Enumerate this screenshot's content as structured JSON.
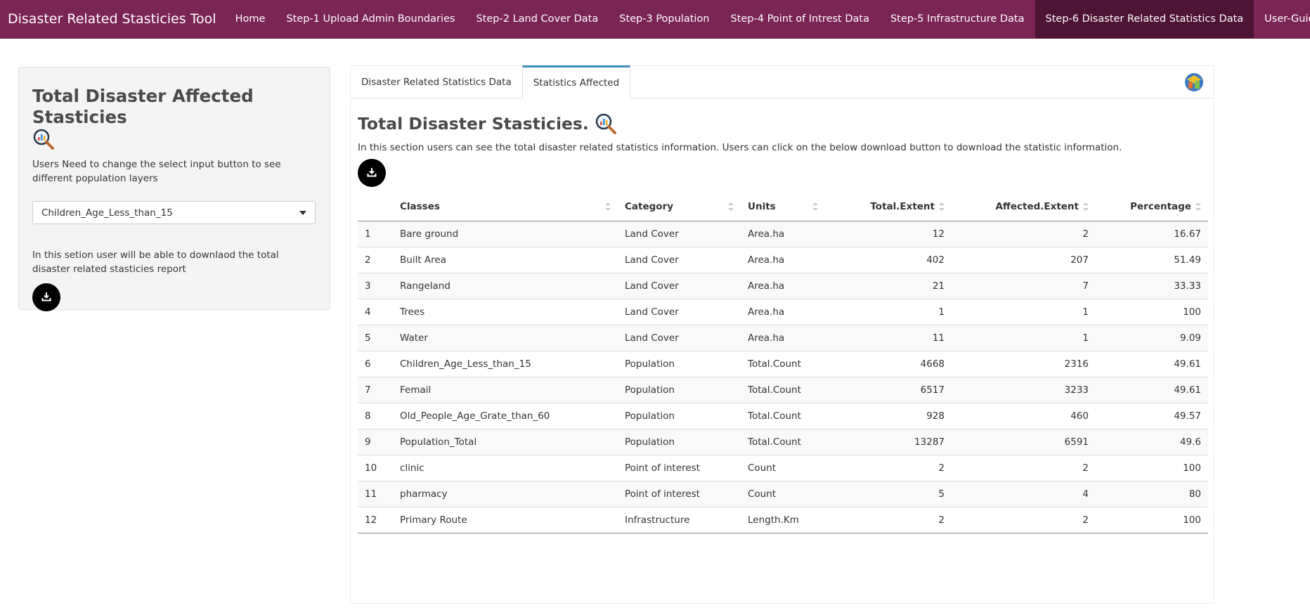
{
  "navbar": {
    "brand": "Disaster Related Stasticies Tool",
    "items": [
      "Home",
      "Step-1 Upload Admin Boundaries",
      "Step-2 Land Cover Data",
      "Step-3 Population",
      "Step-4 Point of Intrest Data",
      "Step-5 Infrastructure Data",
      "Step-6 Disaster Related Statistics Data",
      "User-Guide"
    ],
    "active_index": 6
  },
  "sidebar": {
    "title": "Total Disaster Affected Stasticies",
    "select_hint": "Users Need to change the select input button to see different population layers",
    "select_value": "Children_Age_Less_than_15",
    "download_hint": "In this setion user will be able to downlaod the total disaster related stasticies report",
    "download_icon": "download-icon"
  },
  "main": {
    "tabs": [
      "Disaster Related Statistics Data",
      "Statistics Affected"
    ],
    "active_tab": 1,
    "heading": "Total Disaster Stasticies.",
    "description": "In this section users can see the total disaster related statistics information. Users can click on the below download button to download the statistic information.",
    "table": {
      "columns": [
        "",
        "Classes",
        "Category",
        "Units",
        "Total.Extent",
        "Affected.Extent",
        "Percentage"
      ],
      "rows": [
        [
          "1",
          "Bare ground",
          "Land Cover",
          "Area.ha",
          "12",
          "2",
          "16.67"
        ],
        [
          "2",
          "Built Area",
          "Land Cover",
          "Area.ha",
          "402",
          "207",
          "51.49"
        ],
        [
          "3",
          "Rangeland",
          "Land Cover",
          "Area.ha",
          "21",
          "7",
          "33.33"
        ],
        [
          "4",
          "Trees",
          "Land Cover",
          "Area.ha",
          "1",
          "1",
          "100"
        ],
        [
          "5",
          "Water",
          "Land Cover",
          "Area.ha",
          "11",
          "1",
          "9.09"
        ],
        [
          "6",
          "Children_Age_Less_than_15",
          "Population",
          "Total.Count",
          "4668",
          "2316",
          "49.61"
        ],
        [
          "7",
          "Femail",
          "Population",
          "Total.Count",
          "6517",
          "3233",
          "49.61"
        ],
        [
          "8",
          "Old_People_Age_Grate_than_60",
          "Population",
          "Total.Count",
          "928",
          "460",
          "49.57"
        ],
        [
          "9",
          "Population_Total",
          "Population",
          "Total.Count",
          "13287",
          "6591",
          "49.6"
        ],
        [
          "10",
          "clinic",
          "Point of interest",
          "Count",
          "2",
          "2",
          "100"
        ],
        [
          "11",
          "pharmacy",
          "Point of interest",
          "Count",
          "5",
          "4",
          "80"
        ],
        [
          "12",
          "Primary Route",
          "Infrastructure",
          "Length.Km",
          "2",
          "2",
          "100"
        ]
      ]
    }
  },
  "colors": {
    "navbar_bg": "#7b2456",
    "navbar_active": "#4e1435",
    "tab_accent": "#3c8dbc",
    "button_bg": "#000000"
  }
}
